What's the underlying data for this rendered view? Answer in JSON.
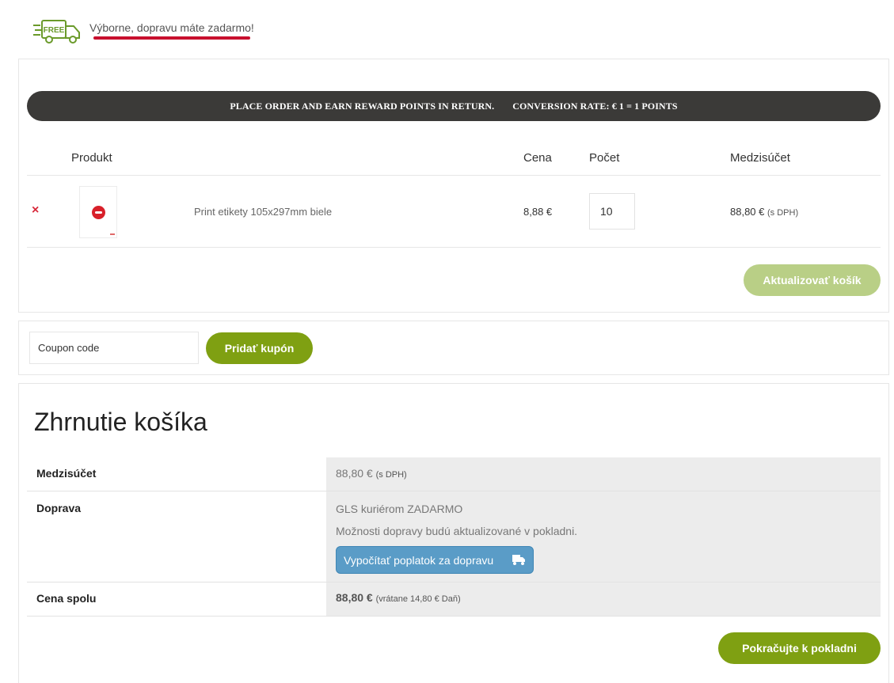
{
  "notice": {
    "badge_text": "FREE",
    "text": "Výborne, dopravu máte zadarmo!"
  },
  "reward": {
    "text_left": "PLACE ORDER AND EARN REWARD POINTS IN RETURN.",
    "text_right": "CONVERSION RATE: € 1 = 1 POINTS"
  },
  "cart": {
    "columns": {
      "product": "Produkt",
      "price": "Cena",
      "quantity": "Počet",
      "subtotal": "Medzisúčet"
    },
    "items": [
      {
        "name": "Print etikety 105x297mm biele",
        "price": "8,88 €",
        "quantity": "10",
        "subtotal": "88,80 €",
        "subtotal_note": "(s DPH)"
      }
    ],
    "update_button": "Aktualizovať košík"
  },
  "coupon": {
    "placeholder": "Coupon code",
    "button": "Pridať kupón"
  },
  "totals": {
    "title": "Zhrnutie košíka",
    "subtotal_label": "Medzisúčet",
    "subtotal_value": "88,80 €",
    "subtotal_note": "(s DPH)",
    "shipping_label": "Doprava",
    "shipping_method": "GLS kuriérom ZADARMO",
    "shipping_note": "Možnosti dopravy budú aktualizované v pokladni.",
    "shipping_calc_button": "Vypočítať poplatok za dopravu",
    "total_label": "Cena spolu",
    "total_value": "88,80 €",
    "total_note": "(vrátane 14,80 € Daň)",
    "checkout_button": "Pokračujte k pokladni"
  },
  "colors": {
    "accent_green": "#7fa012",
    "disabled_green": "#b9cf86",
    "reward_bar": "#3b3a38",
    "underline_red": "#c8102e",
    "shipping_button": "#5a9cc7"
  },
  "icons": [
    "free-shipping-truck-icon",
    "remove-icon",
    "truck-icon"
  ]
}
